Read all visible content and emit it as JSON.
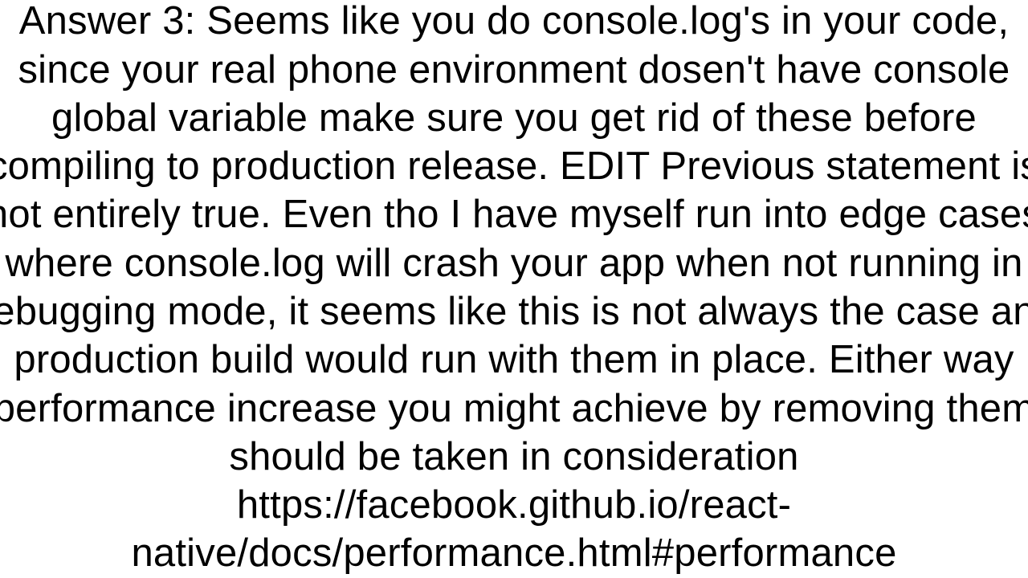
{
  "answer": {
    "label": "Answer 3:",
    "body_part1": "Seems like you do console.log's in your code, since your real phone environment dosen't have console global variable make sure you get rid of these before compiling to production release. EDIT Previous statement is not entirely true. Even tho I have myself run into edge cases where console.log will crash your app when not running in debugging mode, it seems like this is not always the case and production build would run with them in place. Either way performance increase you might achieve by removing them should be taken in consideration",
    "link": "https://facebook.github.io/react-native/docs/performance.html#performance"
  }
}
